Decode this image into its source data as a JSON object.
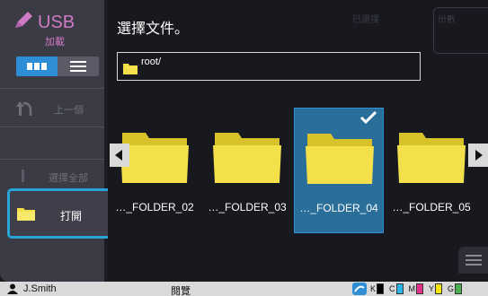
{
  "sidebar": {
    "usb_title": "USB",
    "usb_subtitle": "加載",
    "back_label": "上一個",
    "select_all_label": "選擇全部",
    "open_label": "打開"
  },
  "main": {
    "title": "選擇文件。",
    "selected_label": "已選擇",
    "copies_label": "份數",
    "path": "root/"
  },
  "folders": [
    {
      "name": "…_FOLDER_02",
      "selected": false
    },
    {
      "name": "…_FOLDER_03",
      "selected": false
    },
    {
      "name": "…_FOLDER_04",
      "selected": true
    },
    {
      "name": "…_FOLDER_05",
      "selected": false
    }
  ],
  "status": {
    "user": "J.Smith",
    "mode": "閱覽",
    "toner": [
      {
        "letter": "K",
        "color": "#000000"
      },
      {
        "letter": "C",
        "color": "#29b6e6"
      },
      {
        "letter": "M",
        "color": "#e6308a"
      },
      {
        "letter": "Y",
        "color": "#f2e600"
      },
      {
        "letter": "G",
        "color": "#4caf50"
      }
    ]
  },
  "colors": {
    "accent": "#2f8fd6",
    "usb": "#ce7ac4",
    "folder": "#f3e04a",
    "selected_bg": "#2a6e9a"
  }
}
